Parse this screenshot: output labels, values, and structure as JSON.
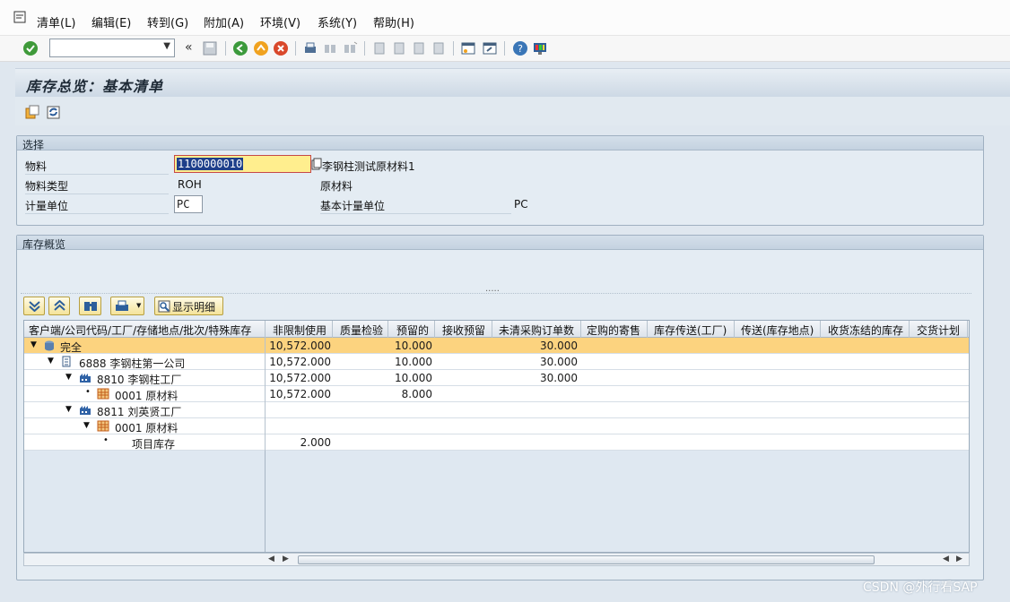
{
  "menu": [
    "清单(L)",
    "编辑(E)",
    "转到(G)",
    "附加(A)",
    "环境(V)",
    "系统(Y)",
    "帮助(H)"
  ],
  "title": "库存总览：基本清单",
  "selection": {
    "header": "选择",
    "material_label": "物料",
    "material_value": "1100000010",
    "material_desc": "李钢柱测试原材料1",
    "material_type_label": "物料类型",
    "material_type_value": "ROH",
    "material_type_desc": "原材料",
    "uom_label": "计量单位",
    "uom_value": "PC",
    "base_uom_label": "基本计量单位",
    "base_uom_value": "PC"
  },
  "overview": {
    "header": "库存概览",
    "show_detail_label": "显示明细",
    "columns": [
      "客户端/公司代码/工厂/存储地点/批次/特殊库存",
      "非限制使用",
      "质量检验",
      "预留的",
      "接收预留",
      "未清采购订单数",
      "定购的寄售",
      "库存传送(工厂)",
      "传送(库存地点)",
      "收货冻结的库存",
      "交货计划"
    ],
    "rows": [
      {
        "label": "完全",
        "unrestricted": "10,572.000",
        "reserved": "10.000",
        "open_po": "30.000"
      },
      {
        "label": "6888 李钢柱第一公司",
        "unrestricted": "10,572.000",
        "reserved": "10.000",
        "open_po": "30.000"
      },
      {
        "label": "8810 李钢柱工厂",
        "unrestricted": "10,572.000",
        "reserved": "10.000",
        "open_po": "30.000"
      },
      {
        "label": "0001 原材料",
        "unrestricted": "10,572.000",
        "reserved": "8.000",
        "open_po": ""
      },
      {
        "label": "8811 刘英贤工厂",
        "unrestricted": "",
        "reserved": "",
        "open_po": ""
      },
      {
        "label": "0001 原材料",
        "unrestricted": "",
        "reserved": "",
        "open_po": ""
      },
      {
        "label": "项目库存",
        "unrestricted": "2.000",
        "reserved": "",
        "open_po": ""
      }
    ]
  },
  "watermark": "CSDN @外行看SAP",
  "colors": {
    "selected_row": "#fcd37f",
    "focus_field": "#ffee8e"
  }
}
